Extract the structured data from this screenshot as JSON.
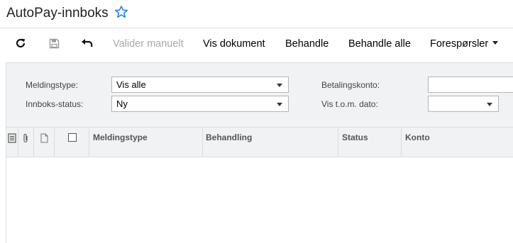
{
  "page": {
    "title": "AutoPay-innboks",
    "favorite_icon": "star-outline-icon",
    "accent_color": "#1e88e5"
  },
  "toolbar": {
    "refresh_icon": "refresh-icon",
    "save_icon": "save-icon",
    "undo_icon": "undo-icon",
    "validate_label": "Valider manuelt",
    "view_doc_label": "Vis dokument",
    "process_label": "Behandle",
    "process_all_label": "Behandle alle",
    "inquiries_label": "Forespørsler"
  },
  "filters": {
    "message_type_label": "Meldingstype:",
    "message_type_value": "Vis alle",
    "inbox_status_label": "Innboks-status:",
    "inbox_status_value": "Ny",
    "payment_account_label": "Betalingskonto:",
    "payment_account_value": "",
    "show_to_date_label": "Vis t.o.m. dato:",
    "show_to_date_value": ""
  },
  "grid": {
    "columns": [
      "Meldingstype",
      "Behandling",
      "Status",
      "Konto"
    ],
    "rows": []
  }
}
